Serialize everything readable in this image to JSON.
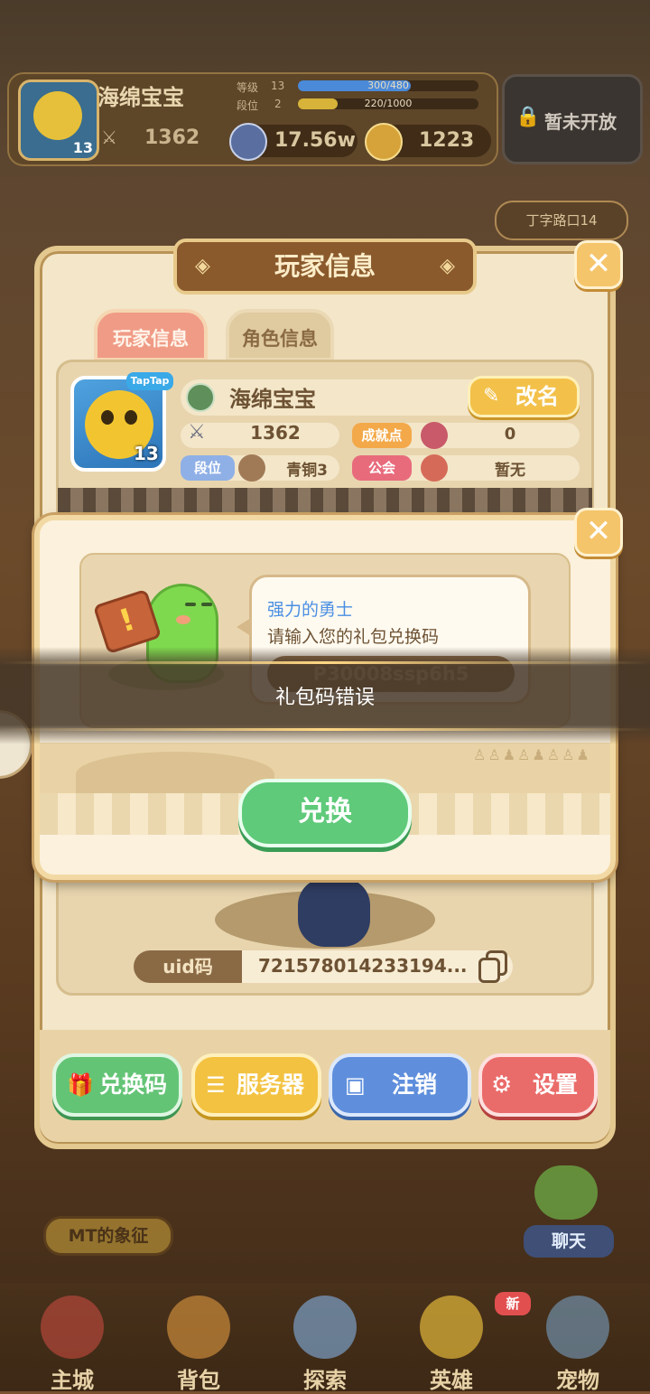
{
  "topbar": {
    "player_name": "海绵宝宝",
    "level": "13",
    "power": "1362",
    "level_label": "等级",
    "level_value": "13",
    "level_progress_text": "300/480",
    "level_progress": 0.625,
    "rank_label": "段位",
    "rank_value": "2",
    "rank_progress_text": "220/1000",
    "rank_progress": 0.22,
    "coins": "17.56w",
    "gems": "1223",
    "locked_label": "暂未开放",
    "side_button": "丁字路口14"
  },
  "panel": {
    "title": "玩家信息",
    "tabs": [
      {
        "label": "玩家信息",
        "active": true
      },
      {
        "label": "角色信息",
        "active": false
      }
    ],
    "avatar_tag": "TapTap",
    "avatar_level": "13",
    "name": "海绵宝宝",
    "rename_label": "改名",
    "power": "1362",
    "achievement_label": "成就点",
    "achievement_value": "0",
    "rank_label": "段位",
    "rank_value": "青铜3",
    "guild_label": "公会",
    "guild_value": "暂无",
    "uid_label": "uid码",
    "uid_value": "721578014233194..."
  },
  "modal": {
    "speaker": "强力的勇士",
    "prompt": "请输入您的礼包兑换码",
    "code_value": "P30008ssp6h5",
    "redeem_label": "兑换"
  },
  "toast": {
    "message": "礼包码错误"
  },
  "actions": [
    {
      "label": "兑换码",
      "icon": "gift-icon"
    },
    {
      "label": "服务器",
      "icon": "server-icon"
    },
    {
      "label": "注销",
      "icon": "id-card-icon"
    },
    {
      "label": "设置",
      "icon": "gear-icon"
    }
  ],
  "bottom": {
    "mt_badge": "MT的象征",
    "chat": "聊天",
    "new_tag": "新"
  },
  "nav": [
    {
      "label": "主城",
      "icon": "castle-icon"
    },
    {
      "label": "背包",
      "icon": "backpack-icon"
    },
    {
      "label": "探索",
      "icon": "map-icon"
    },
    {
      "label": "英雄",
      "icon": "hero-icon"
    },
    {
      "label": "宠物",
      "icon": "pet-icon"
    }
  ],
  "colors": {
    "panel_bg": "#f3e6c9",
    "tab_active": "#f09b86",
    "redeem_green": "#5fca7a",
    "speaker_blue": "#4a8fe3",
    "rename_yellow": "#f3c14a"
  }
}
